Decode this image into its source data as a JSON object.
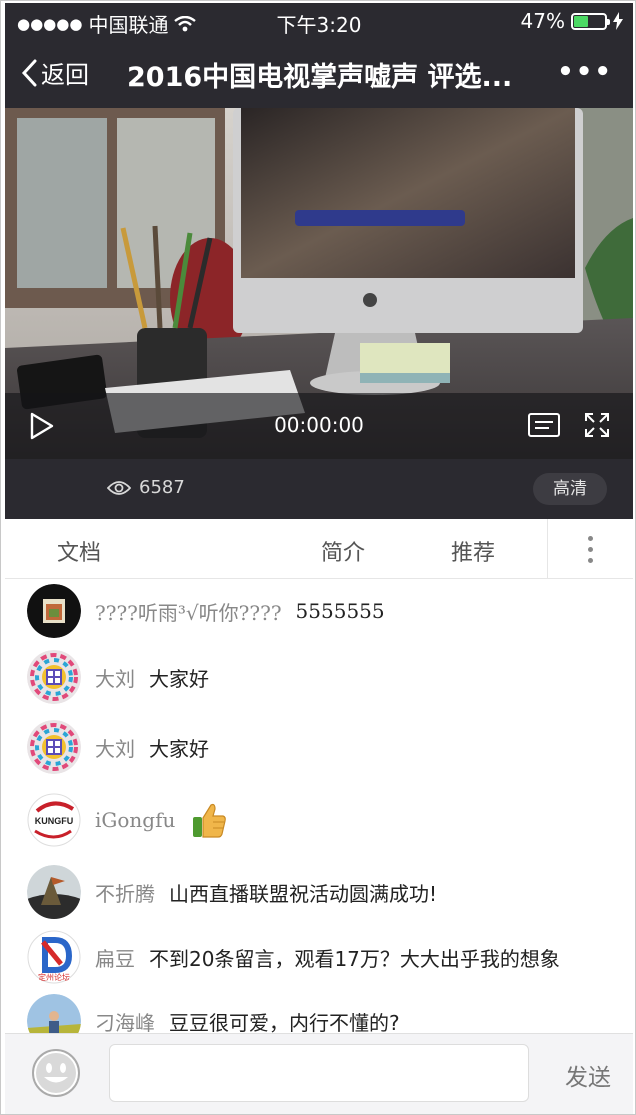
{
  "status_bar": {
    "carrier": "中国联通",
    "time": "下午3:20",
    "battery": "47%",
    "battery_level": 0.47
  },
  "navbar": {
    "back_label": "返回",
    "title": "2016中国电视掌声嘘声 评选...",
    "more_label": "•••"
  },
  "video": {
    "time": "00:00:00"
  },
  "info": {
    "views": "6587",
    "quality": "高清"
  },
  "tabs": {
    "doc": "文档",
    "intro": "简介",
    "recommend": "推荐"
  },
  "comments": [
    {
      "name": "????听雨³√听你????",
      "text": "5555555"
    },
    {
      "name": "大刘",
      "text": "大家好"
    },
    {
      "name": "大刘",
      "text": "大家好"
    },
    {
      "name": "iGongfu",
      "text": ""
    },
    {
      "name": "不折腾",
      "text": "山西直播联盟祝活动圆满成功!"
    },
    {
      "name": "扁豆",
      "text": "不到20条留言，观看17万？大大出乎我的想象"
    },
    {
      "name": "刁海峰",
      "text": "豆豆很可爱，内行不懂的?"
    }
  ],
  "avatar_texts": {
    "kungfu": "KUNGFU",
    "dingzhou": "定州论坛"
  },
  "bottom_bar": {
    "input_value": "",
    "send_label": "发送"
  },
  "colors": {
    "header_bg": "#2b2a30",
    "battery_green": "#4cd964"
  }
}
